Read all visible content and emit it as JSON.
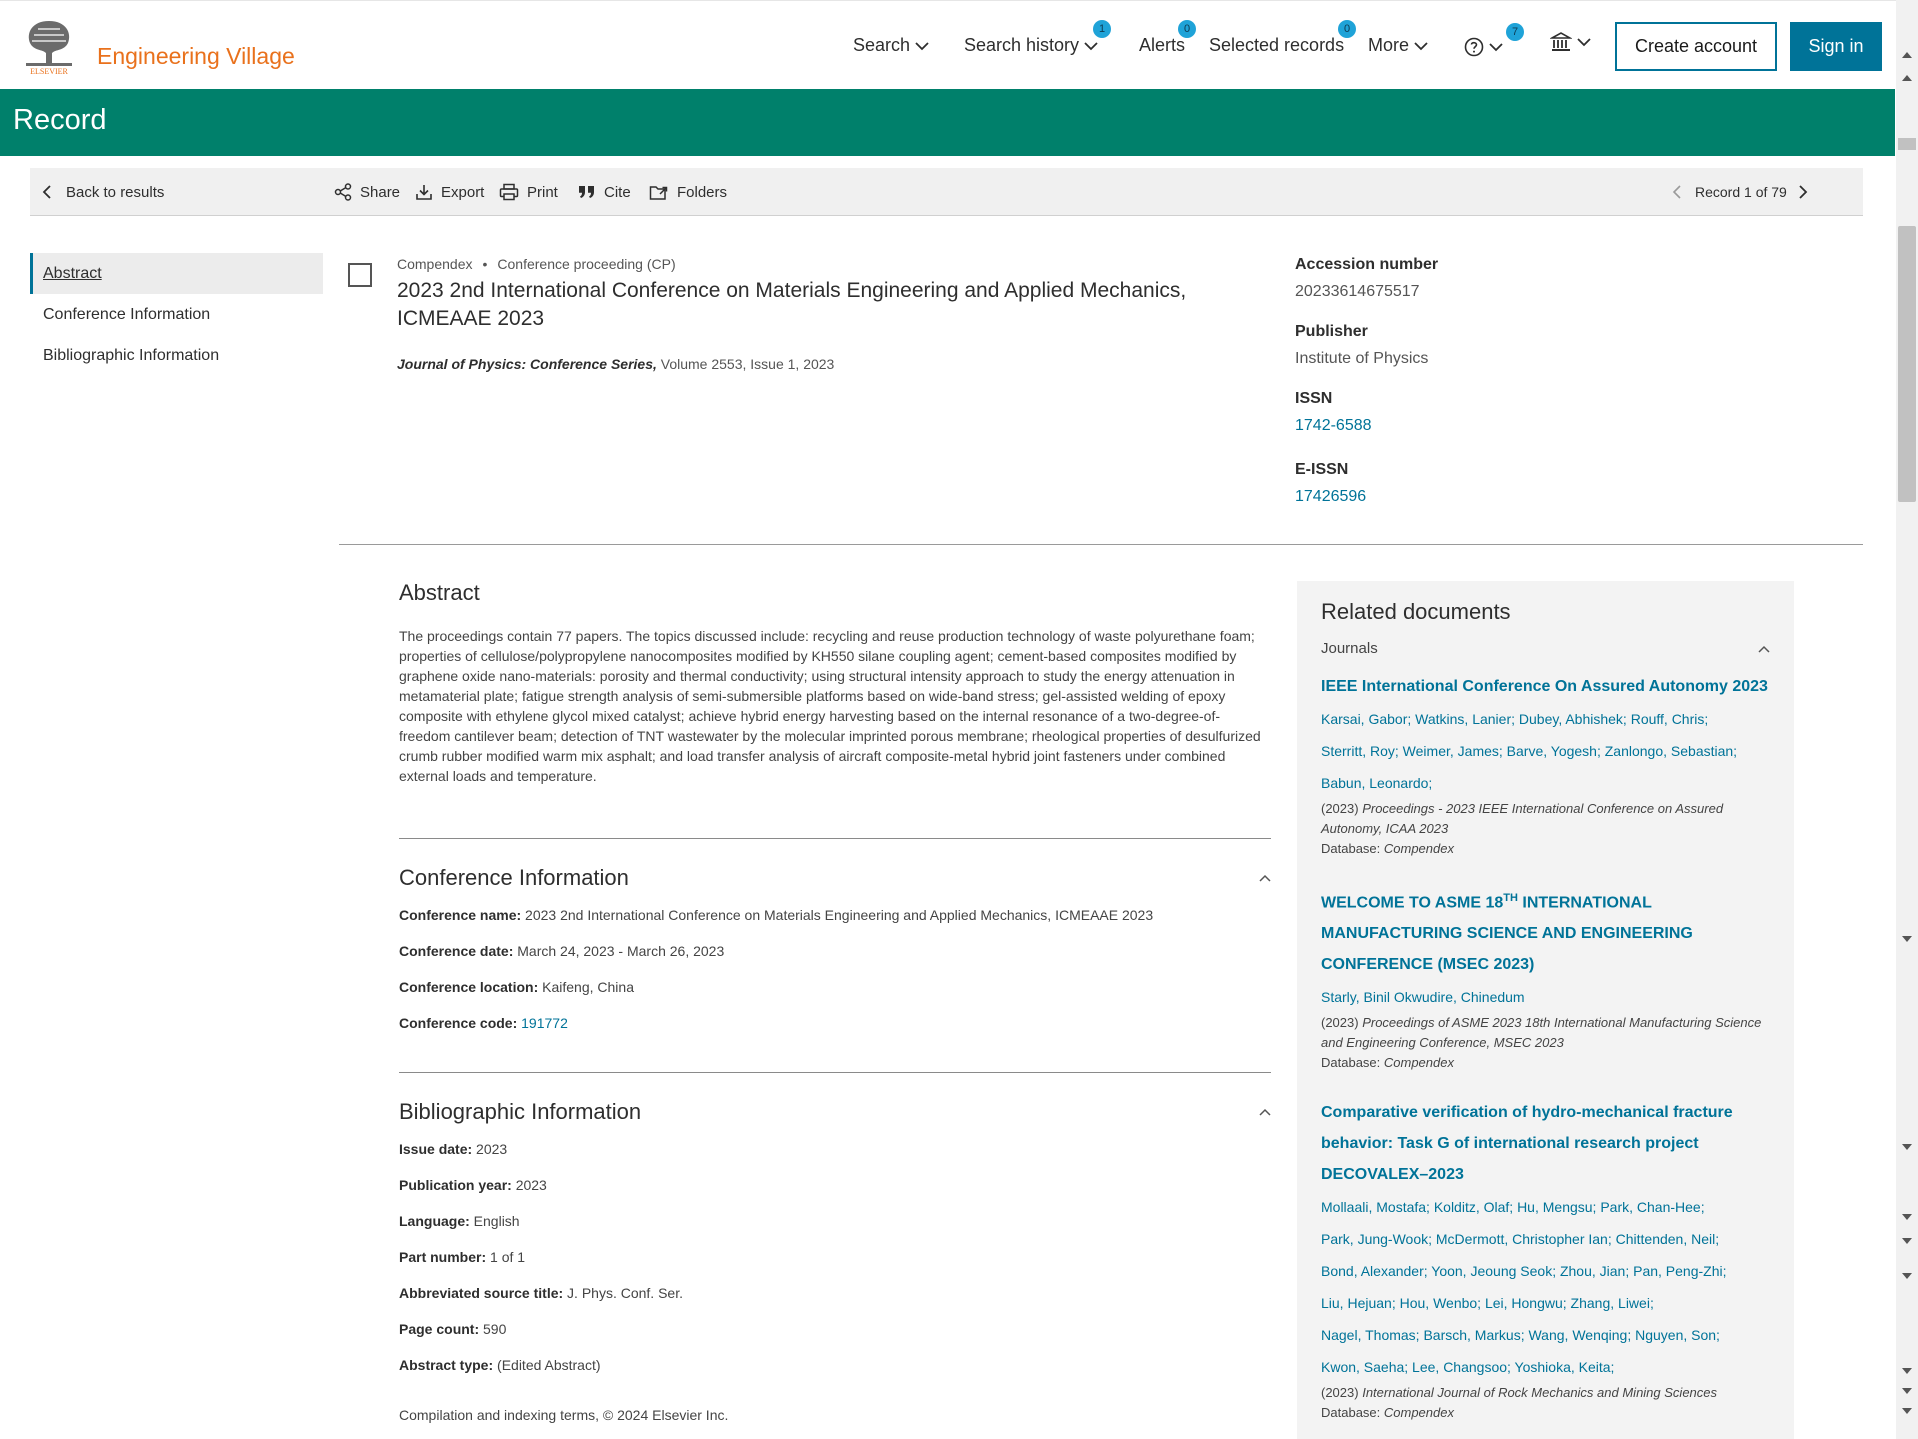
{
  "header": {
    "logo_text": "Engineering Village",
    "nav": {
      "search": "Search",
      "search_history": "Search history",
      "search_history_count": "1",
      "alerts": "Alerts",
      "alerts_count": "0",
      "selected_records": "Selected records",
      "selected_records_count": "0",
      "more": "More",
      "help_count": "7"
    },
    "create_account": "Create account",
    "sign_in": "Sign in"
  },
  "banner": {
    "title": "Record"
  },
  "toolbar": {
    "back": "Back to results",
    "share": "Share",
    "export": "Export",
    "print": "Print",
    "cite": "Cite",
    "folders": "Folders",
    "record_position": "Record 1 of 79"
  },
  "leftnav": {
    "items": [
      "Abstract",
      "Conference Information",
      "Bibliographic Information"
    ]
  },
  "record": {
    "database": "Compendex",
    "doc_type": "Conference proceeding (CP)",
    "title": "2023 2nd International Conference on Materials Engineering and Applied Mechanics, ICMEAAE 2023",
    "source_journal": "Journal of Physics: Conference Series,",
    "source_details": " Volume 2553, Issue 1, 2023"
  },
  "facts": {
    "accession_label": "Accession number",
    "accession_value": "20233614675517",
    "publisher_label": "Publisher",
    "publisher_value": "Institute of Physics",
    "issn_label": "ISSN",
    "issn_value": "1742-6588",
    "eissn_label": "E-ISSN",
    "eissn_value": "17426596"
  },
  "abstract": {
    "title": "Abstract",
    "text": "The proceedings contain 77 papers. The topics discussed include: recycling and reuse production technology of waste polyurethane foam; properties of cellulose/polypropylene nanocomposites modified by KH550 silane coupling agent; cement-based composites modified by graphene oxide nano-materials: porosity and thermal conductivity; using structural intensity approach to study the energy attenuation in metamaterial plate; fatigue strength analysis of semi-submersible platforms based on wide-band stress; gel-assisted welding of epoxy composite with ethylene glycol mixed catalyst; achieve hybrid energy harvesting based on the internal resonance of a two-degree-of-freedom cantilever beam; detection of TNT wastewater by the molecular imprinted porous membrane; rheological properties of desulfurized crumb rubber modified warm mix asphalt; and load transfer analysis of aircraft composite-metal hybrid joint fasteners under combined external loads and temperature."
  },
  "conference": {
    "title": "Conference Information",
    "name_label": "Conference name:",
    "name_value": "2023 2nd International Conference on Materials Engineering and Applied Mechanics, ICMEAAE 2023",
    "date_label": "Conference date:",
    "date_value": "March 24, 2023 - March 26, 2023",
    "location_label": "Conference location:",
    "location_value": "Kaifeng, China",
    "code_label": "Conference code:",
    "code_value": "191772"
  },
  "bibliographic": {
    "title": "Bibliographic Information",
    "fields": [
      {
        "label": "Issue date:",
        "value": "2023"
      },
      {
        "label": "Publication year:",
        "value": "2023"
      },
      {
        "label": "Language:",
        "value": "English"
      },
      {
        "label": "Part number:",
        "value": "1 of 1"
      },
      {
        "label": "Abbreviated source title:",
        "value": "J. Phys. Conf. Ser."
      },
      {
        "label": "Page count:",
        "value": "590"
      },
      {
        "label": "Abstract type:",
        "value": "(Edited Abstract)"
      }
    ],
    "copyright": "Compilation and indexing terms, © 2024 Elsevier Inc."
  },
  "related": {
    "title": "Related documents",
    "subtitle": "Journals",
    "docs": [
      {
        "title": "IEEE International Conference On Assured Autonomy 2023",
        "authors": [
          "Karsai, Gabor; Watkins, Lanier; Dubey, Abhishek; Rouff, Chris;",
          "Sterritt, Roy; Weimer, James; Barve, Yogesh; Zanlongo, Sebastian;",
          "Babun, Leonardo;"
        ],
        "year": "(2023) ",
        "venue": "Proceedings - 2023 IEEE International Conference on Assured Autonomy, ICAA 2023",
        "db_label": "Database: ",
        "db": "Compendex"
      },
      {
        "title_pre": "WELCOME TO ASME 18",
        "title_sup": "TH",
        "title_post": " INTERNATIONAL MANUFACTURING SCIENCE AND ENGINEERING CONFERENCE (MSEC 2023)",
        "authors": [
          "Starly, Binil Okwudire, Chinedum"
        ],
        "year": "(2023) ",
        "venue": "Proceedings of ASME 2023 18th International Manufacturing Science and Engineering Conference, MSEC 2023",
        "db_label": "Database: ",
        "db": "Compendex"
      },
      {
        "title": "Comparative verification of hydro-mechanical fracture behavior: Task G of international research project DECOVALEX–2023",
        "authors": [
          "Mollaali, Mostafa; Kolditz, Olaf; Hu, Mengsu; Park, Chan-Hee;",
          "Park, Jung-Wook; McDermott, Christopher Ian; Chittenden, Neil;",
          "Bond, Alexander; Yoon, Jeoung Seok; Zhou, Jian; Pan, Peng-Zhi;",
          "Liu, Hejuan; Hou, Wenbo; Lei, Hongwu; Zhang, Liwei;",
          "Nagel, Thomas; Barsch, Markus; Wang, Wenqing; Nguyen, Son;",
          "Kwon, Saeha; Lee, Changsoo; Yoshioka, Keita;"
        ],
        "year": "(2023) ",
        "venue": "International Journal of Rock Mechanics and Mining Sciences",
        "db_label": "Database: ",
        "db": "Compendex"
      }
    ]
  },
  "colors": {
    "brand_orange": "#e9711c",
    "banner_green": "#00806b",
    "link_blue": "#007398",
    "badge_blue": "#1fa3d8"
  },
  "icons": [
    "elsevier-tree-logo",
    "chevron-down-icon",
    "help-icon",
    "institution-icon",
    "chevron-left-icon",
    "share-icon",
    "export-icon",
    "print-icon",
    "cite-icon",
    "folders-icon",
    "chevron-right-icon",
    "chevron-up-icon"
  ]
}
